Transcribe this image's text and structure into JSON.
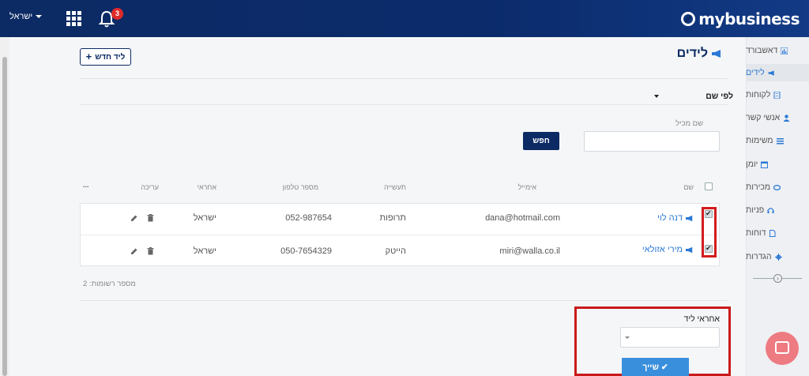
{
  "header": {
    "user_menu_label": "ישראל",
    "notification_count": "3",
    "brand": "mybusiness"
  },
  "sidebar": {
    "items": [
      {
        "label": "דאשבורד",
        "icon": "chart-icon"
      },
      {
        "label": "לידים",
        "icon": "megaphone-icon",
        "active": true
      },
      {
        "label": "לקוחות",
        "icon": "building-icon"
      },
      {
        "label": "אנשי קשר",
        "icon": "person-icon"
      },
      {
        "label": "משימות",
        "icon": "list-icon"
      },
      {
        "label": "יומן",
        "icon": "calendar-icon"
      },
      {
        "label": "מכירות",
        "icon": "handshake-icon"
      },
      {
        "label": "פניות",
        "icon": "headset-icon"
      },
      {
        "label": "דוחות",
        "icon": "document-icon"
      },
      {
        "label": "הגדרות",
        "icon": "gear-icon"
      }
    ]
  },
  "page": {
    "title": "לידים",
    "new_lead_label": "ליד חדש",
    "sort_label": "לפי שם",
    "search_label": "שם מכיל",
    "search_placeholder": "",
    "search_button": "חפש",
    "record_count": "מספר רשומות: 2"
  },
  "table": {
    "columns": {
      "name": "שם",
      "email": "אימייל",
      "industry": "תעשייה",
      "phone": "מספר טלפון",
      "owner": "אחראי",
      "edit": "עריכה",
      "more": "..."
    },
    "rows": [
      {
        "name": "דנה לוי",
        "email": "dana@hotmail.com",
        "industry": "תרופות",
        "phone": "052-987654",
        "owner": "ישראל",
        "checked": true
      },
      {
        "name": "מירי אזולאי",
        "email": "miri@walla.co.il",
        "industry": "הייטק",
        "phone": "050-7654329",
        "owner": "ישראל",
        "checked": true
      }
    ]
  },
  "assign": {
    "label": "אחראי ליד",
    "select_value": "",
    "button_label": "שייך"
  },
  "colors": {
    "topbar": "#0c2a63",
    "accent": "#2b79d6",
    "highlight": "#d21c1c",
    "chat": "#ee7a82"
  }
}
